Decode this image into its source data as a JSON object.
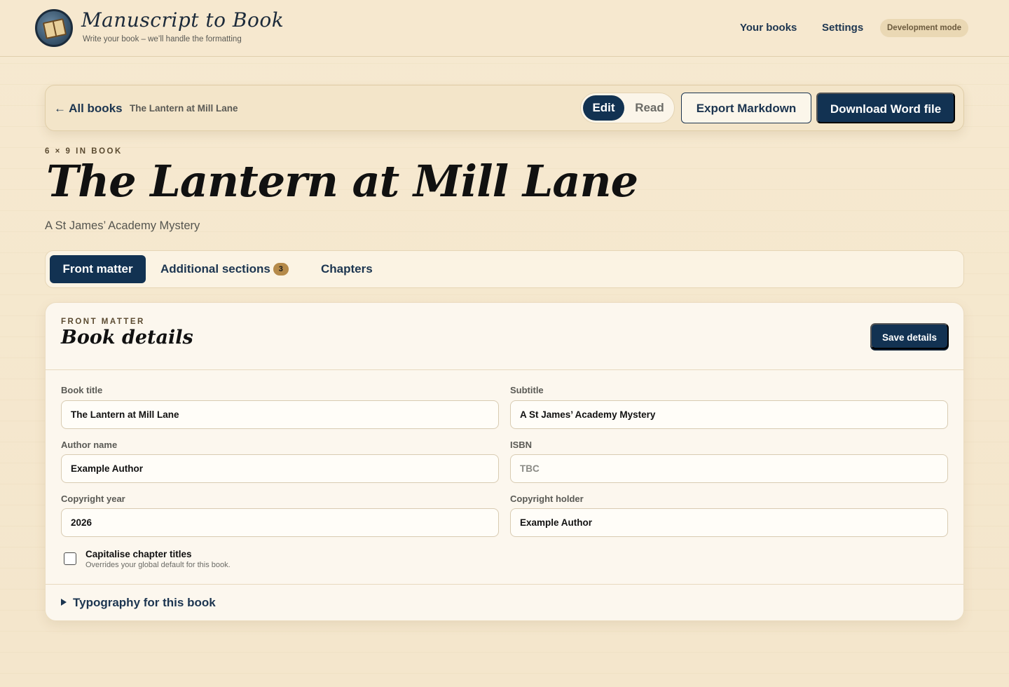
{
  "brand": {
    "title": "Manuscript to Book",
    "tagline": "Write your book – we’ll handle the formatting"
  },
  "nav": {
    "your_books": "Your books",
    "settings": "Settings",
    "badge": "Development mode"
  },
  "toolbar": {
    "back_label": "← All books",
    "breadcrumb": "The Lantern at Mill Lane",
    "mode_edit": "Edit",
    "mode_read": "Read",
    "active_mode": "Edit",
    "export_markdown": "Export Markdown",
    "download_word": "Download Word file"
  },
  "book": {
    "trim": "6 × 9 IN BOOK",
    "title": "The Lantern at Mill Lane",
    "subtitle": "A St James’ Academy Mystery"
  },
  "tabs": {
    "items": [
      {
        "label": "Front matter",
        "active": true
      },
      {
        "label": "Additional sections",
        "count": "3"
      },
      {
        "label": "Chapters"
      }
    ]
  },
  "card": {
    "eyebrow": "FRONT MATTER",
    "title": "Book details",
    "save_label": "Save details",
    "fields": {
      "book_title": {
        "label": "Book title",
        "value": "The Lantern at Mill Lane"
      },
      "subtitle": {
        "label": "Subtitle",
        "value": "A St James’ Academy Mystery"
      },
      "author": {
        "label": "Author name",
        "value": "Example Author"
      },
      "isbn": {
        "label": "ISBN",
        "value": "",
        "placeholder": "TBC"
      },
      "copyright_year": {
        "label": "Copyright year",
        "value": "2026"
      },
      "copyright_holder": {
        "label": "Copyright holder",
        "value": "Example Author"
      }
    },
    "capitalise": {
      "label": "Capitalise chapter titles",
      "help": "Overrides your global default for this book.",
      "checked": false
    },
    "typography_label": "Typography for this book"
  },
  "colors": {
    "primary": "#123252",
    "background": "#f6e9d0",
    "accent_badge": "#b58a4a"
  }
}
